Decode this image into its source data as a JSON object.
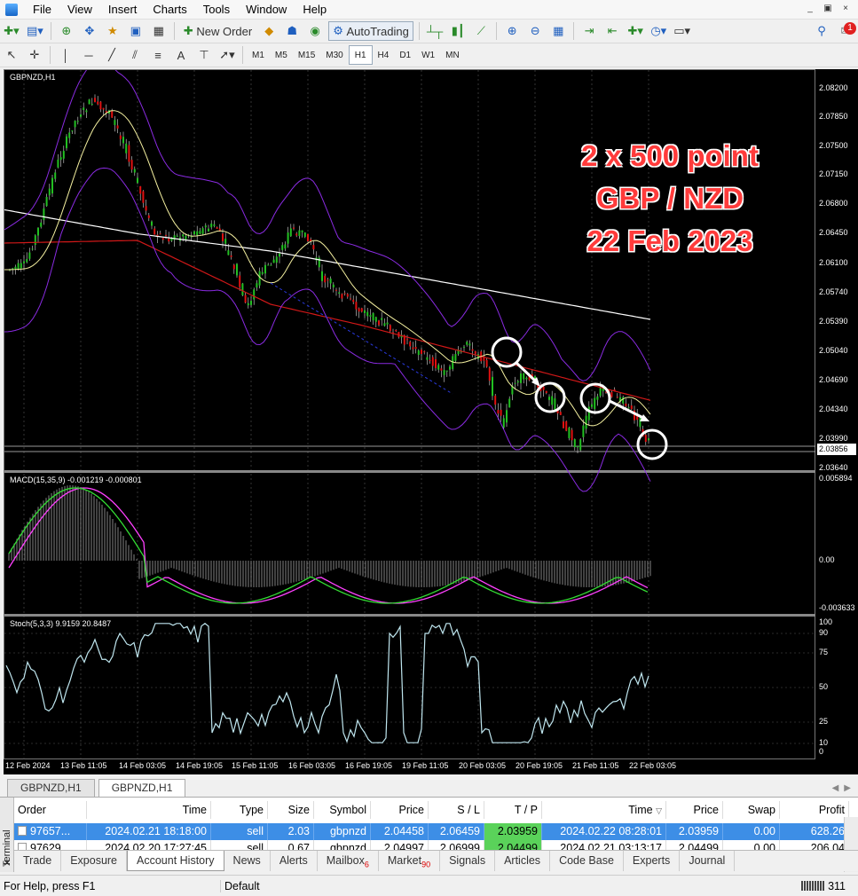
{
  "menu": [
    "File",
    "View",
    "Insert",
    "Charts",
    "Tools",
    "Window",
    "Help"
  ],
  "window_controls": [
    "_",
    "▣",
    "×"
  ],
  "toolbar": {
    "new_order_label": "New Order",
    "autotrading_label": "AutoTrading",
    "notify_count": "1",
    "timeframes": [
      "M1",
      "M5",
      "M15",
      "M30",
      "H1",
      "H4",
      "D1",
      "W1",
      "MN"
    ],
    "active_timeframe": "H1"
  },
  "chart": {
    "symbol_label": "GBPNZD,H1",
    "macd_label": "MACD(15,35,9) -0.001219 -0.000801",
    "stoch_label": "Stoch(5,3,3) 9.9159 20.8487",
    "overlay_lines": [
      "2 x 500 point",
      "GBP / NZD",
      "22 Feb 2023"
    ],
    "price_scale": [
      "2.08200",
      "2.07850",
      "2.07500",
      "2.07150",
      "2.06800",
      "2.06450",
      "2.06100",
      "2.05740",
      "2.05390",
      "2.05040",
      "2.04690",
      "2.04340",
      "2.03990",
      "2.03640"
    ],
    "current_price": "2.03856",
    "macd_scale": [
      "0.005894",
      "0.00",
      "-0.003633"
    ],
    "stoch_scale": [
      "100",
      "90",
      "75",
      "50",
      "25",
      "10",
      "0"
    ],
    "time_axis": [
      "12 Feb 2024",
      "13 Feb 11:05",
      "14 Feb 03:05",
      "14 Feb 19:05",
      "15 Feb 11:05",
      "16 Feb 03:05",
      "16 Feb 19:05",
      "19 Feb 11:05",
      "20 Feb 03:05",
      "20 Feb 19:05",
      "21 Feb 11:05",
      "22 Feb 03:05"
    ],
    "colors": {
      "bull": "#22c022",
      "bear": "#e01010",
      "ma_white": "#ffffff",
      "ma_red": "#d01818",
      "ma_yellow": "#f4f0a0",
      "bands": "#8a2be2",
      "macd_signal": "#ff40ff",
      "macd_line": "#33dd33",
      "stoch": "#bfe6ef"
    }
  },
  "chart_tabs": [
    "GBPNZD,H1",
    "GBPNZD,H1"
  ],
  "terminal": {
    "side_label": "Terminal",
    "columns": [
      "Order",
      "Time",
      "Type",
      "Size",
      "Symbol",
      "Price",
      "S / L",
      "T / P",
      "Time",
      "Price",
      "Swap",
      "Profit"
    ],
    "rows": [
      [
        "97657...",
        "2024.02.21 18:18:00",
        "sell",
        "2.03",
        "gbpnzd",
        "2.04458",
        "2.06459",
        "2.03959",
        "2024.02.22 08:28:01",
        "2.03959",
        "0.00",
        "628.26"
      ],
      [
        "97629...",
        "2024.02.20 17:27:45",
        "sell",
        "0.67",
        "gbpnzd",
        "2.04997",
        "2.06999",
        "2.04499",
        "2024.02.21 03:13:17",
        "2.04499",
        "0.00",
        "206.04"
      ]
    ],
    "tabs": [
      "Trade",
      "Exposure",
      "Account History",
      "News",
      "Alerts",
      "Mailbox",
      "Market",
      "Signals",
      "Articles",
      "Code Base",
      "Experts",
      "Journal"
    ],
    "active_tab": "Account History",
    "mailbox_count": "6",
    "market_count": "90"
  },
  "status": {
    "help": "For Help, press F1",
    "profile": "Default",
    "traffic": "311"
  }
}
